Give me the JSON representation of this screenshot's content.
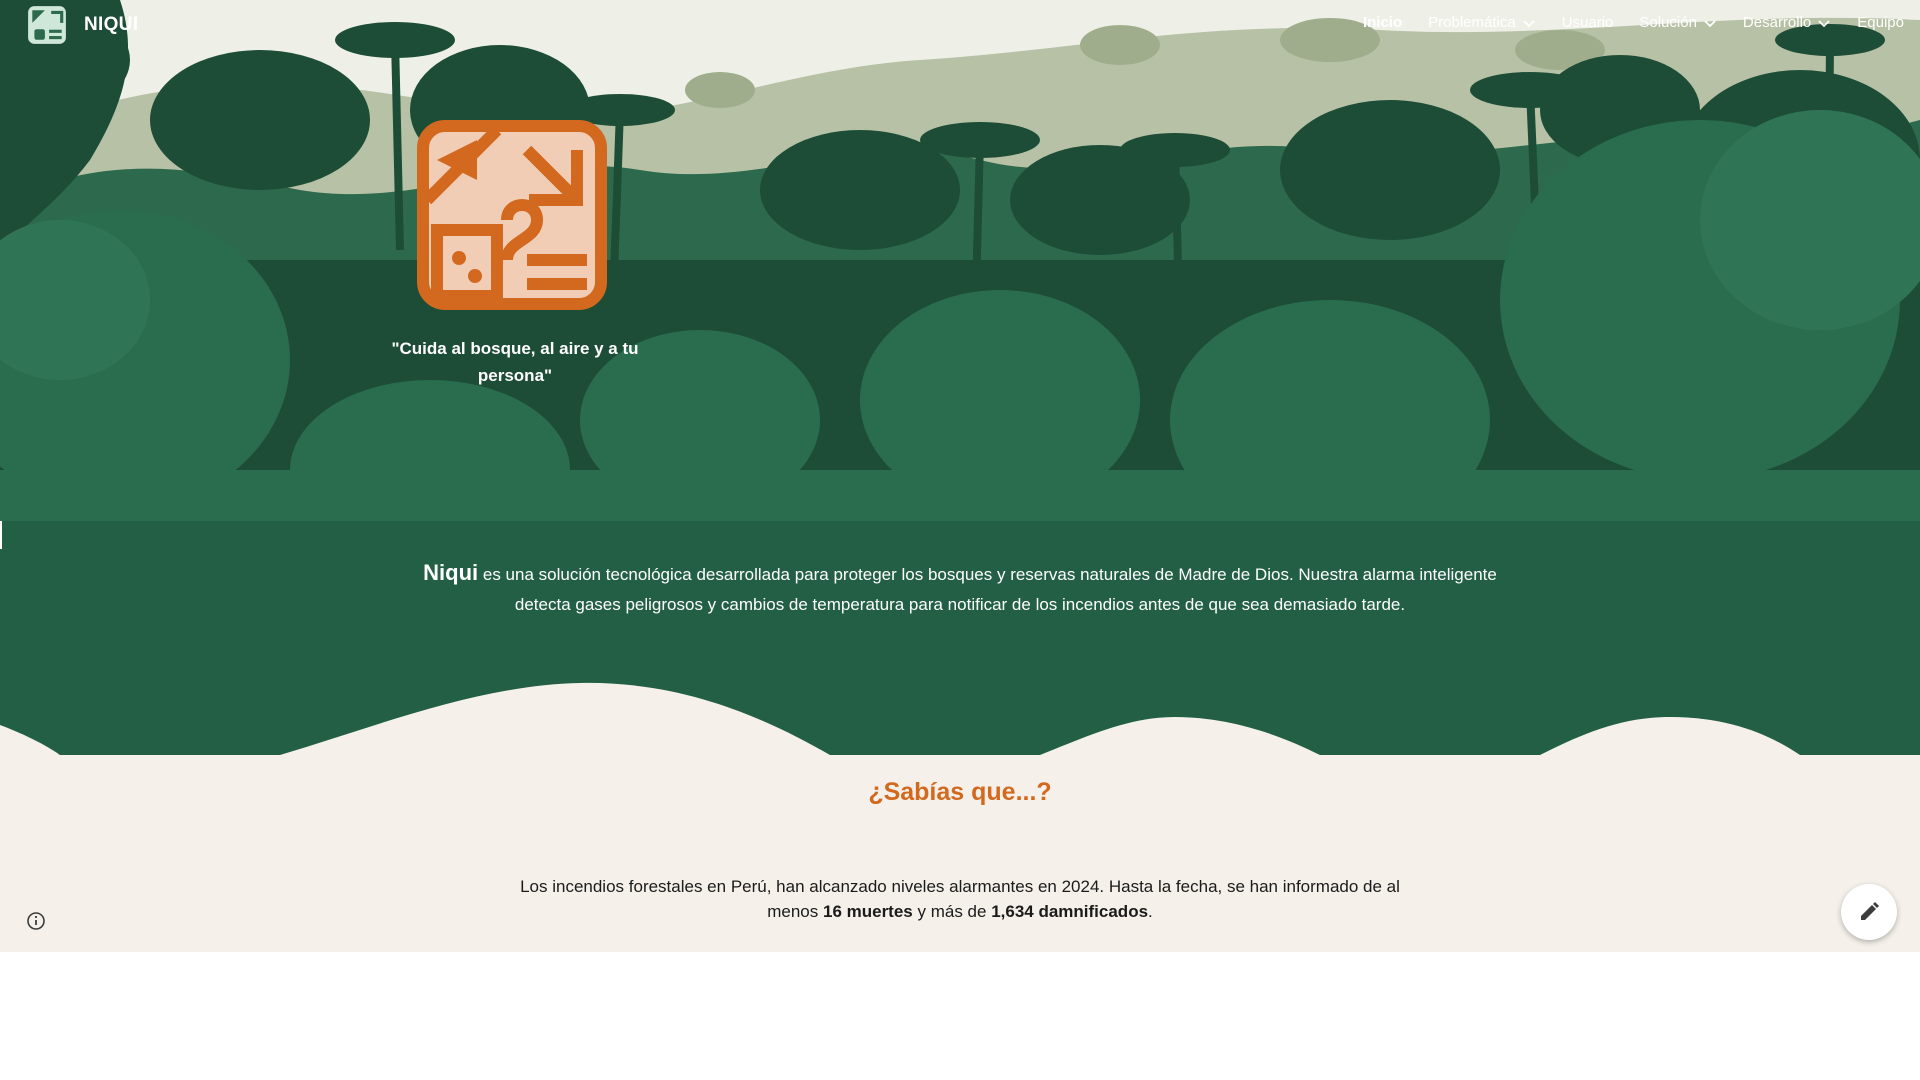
{
  "nav": {
    "brand": "NIQUI",
    "items": [
      {
        "label": "Inicio",
        "dropdown": false,
        "active": true
      },
      {
        "label": "Problemática",
        "dropdown": true,
        "active": false
      },
      {
        "label": "Usuario",
        "dropdown": false,
        "active": false
      },
      {
        "label": "Solución",
        "dropdown": true,
        "active": false
      },
      {
        "label": "Desarrollo",
        "dropdown": true,
        "active": false
      },
      {
        "label": "Equipo",
        "dropdown": false,
        "active": false
      }
    ]
  },
  "hero": {
    "quote": "\"Cuida al bosque, al aire y a tu persona\""
  },
  "intro": {
    "brand_word": "Niqui",
    "text": " es una solución tecnológica desarrollada para proteger los bosques y reservas naturales de Madre de Dios. Nuestra alarma inteligente detecta gases peligrosos y cambios de temperatura para notificar de los incendios antes de que sea demasiado tarde."
  },
  "sabias": {
    "title": "¿Sabías que...?",
    "fact_part1": "Los incendios forestales en Perú, han alcanzado niveles alarmantes en 2024. Hasta la fecha, se han informado de al menos ",
    "fact_bold1": "16 muertes",
    "fact_part2": " y más de ",
    "fact_bold2": "1,634 damnificados",
    "fact_part3": "."
  },
  "colors": {
    "forest_dark": "#1d4d36",
    "forest_mid": "#225f45",
    "sky": "#b7c1a6",
    "accent_orange": "#d2691e",
    "logo_fill": "#f2cdb6",
    "background": "#f5f1ea"
  },
  "icons": {
    "info": "info-icon",
    "edit": "pencil-icon",
    "dropdown": "chevron-down-icon"
  }
}
